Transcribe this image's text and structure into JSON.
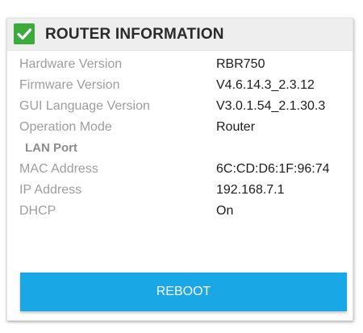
{
  "header": {
    "icon": "check-icon",
    "title": "ROUTER INFORMATION",
    "accent_color": "#3bab3b"
  },
  "info_rows": [
    {
      "label": "Hardware Version",
      "value": "RBR750"
    },
    {
      "label": "Firmware Version",
      "value": "V4.6.14.3_2.3.12"
    },
    {
      "label": "GUI Language Version",
      "value": "V3.0.1.54_2.1.30.3"
    },
    {
      "label": "Operation Mode",
      "value": "Router"
    }
  ],
  "lan_section": {
    "title": "LAN Port",
    "rows": [
      {
        "label": "MAC Address",
        "value": "6C:CD:D6:1F:96:74"
      },
      {
        "label": "IP Address",
        "value": "192.168.7.1"
      },
      {
        "label": "DHCP",
        "value": "On"
      }
    ]
  },
  "actions": {
    "reboot_label": "REBOOT",
    "reboot_color": "#1aa7e6"
  }
}
